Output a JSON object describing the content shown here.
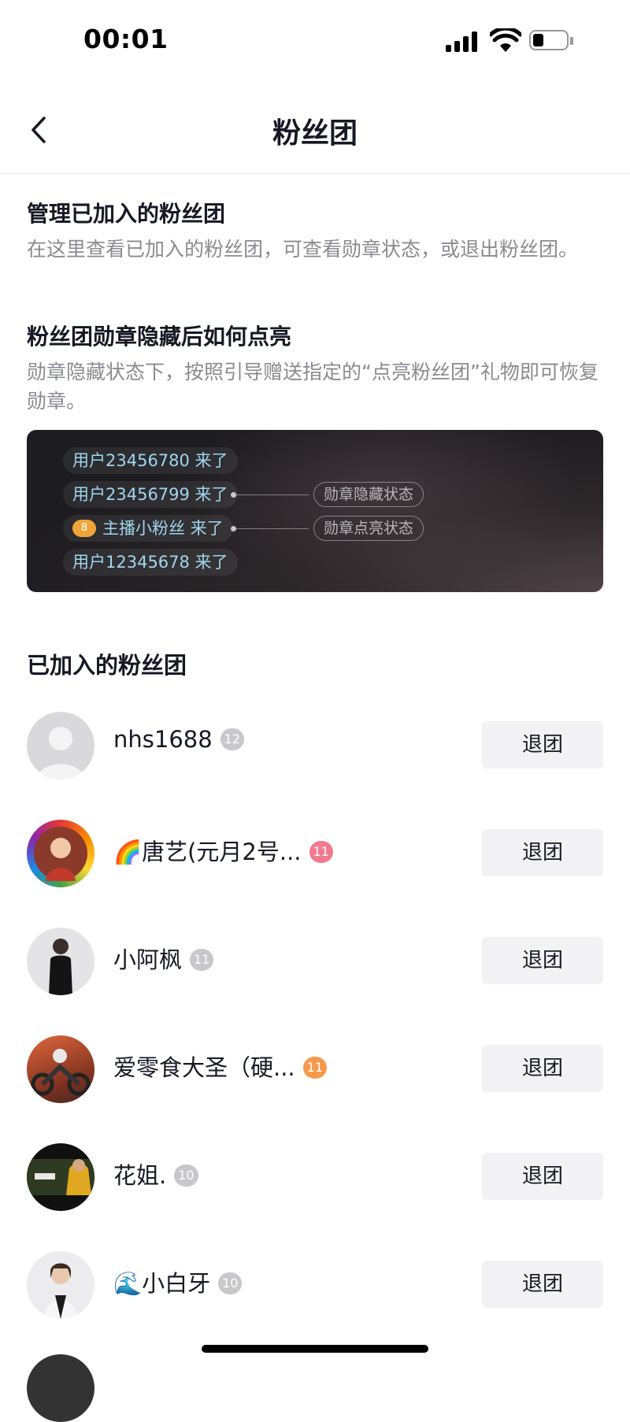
{
  "status_bar": {
    "time": "00:01"
  },
  "nav": {
    "title": "粉丝团",
    "back_icon": "chevron-left-icon"
  },
  "manage": {
    "title": "管理已加入的粉丝团",
    "desc": "在这里查看已加入的粉丝团，可查看勋章状态，或退出粉丝团。"
  },
  "light_up": {
    "title": "粉丝团勋章隐藏后如何点亮",
    "desc": "勋章隐藏状态下，按照引导赠送指定的“点亮粉丝团”礼物即可恢复勋章。"
  },
  "banner": {
    "lines": [
      {
        "text": "用户23456780 来了"
      },
      {
        "text": "用户23456799 来了"
      },
      {
        "badge": "8",
        "text": "主播小粉丝 来了"
      },
      {
        "text": "用户12345678 来了"
      }
    ],
    "labels": {
      "hidden": "勋章隐藏状态",
      "lit": "勋章点亮状态"
    }
  },
  "joined": {
    "title": "已加入的粉丝团",
    "quit_label": "退团",
    "items": [
      {
        "name": "nhs1688",
        "level": "12",
        "badge_color": "#c8c8cc"
      },
      {
        "name": "🌈唐艺(元月2号...",
        "level": "11",
        "badge_color": "#f17a8e"
      },
      {
        "name": "小阿枫",
        "level": "11",
        "badge_color": "#c8c8cc"
      },
      {
        "name": "爱零食大圣（硬...",
        "level": "11",
        "badge_color": "#f59a4d"
      },
      {
        "name": "花姐.",
        "level": "10",
        "badge_color": "#c8c8cc"
      },
      {
        "name": "🌊小白牙",
        "level": "10",
        "badge_color": "#c8c8cc"
      }
    ]
  },
  "colors": {
    "banner_text": "#9fd6ef",
    "button_bg": "#f2f2f4",
    "muted_text": "#8a8b91"
  }
}
